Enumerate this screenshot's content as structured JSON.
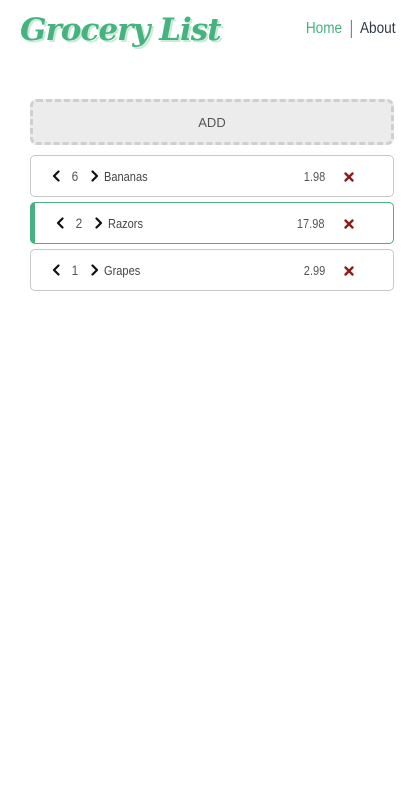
{
  "header": {
    "logo": "Grocery List",
    "nav": {
      "home": "Home",
      "about": "About"
    }
  },
  "add_button": {
    "label": "ADD"
  },
  "items": [
    {
      "qty": "6",
      "name": "Bananas",
      "price": "1.98"
    },
    {
      "qty": "2",
      "name": "Razors",
      "price": "17.98"
    },
    {
      "qty": "1",
      "name": "Grapes",
      "price": "2.99"
    }
  ],
  "colors": {
    "accent": "#45b27f",
    "remove": "#8b1a1a",
    "text": "#444444"
  },
  "icons": {
    "decrease": "chevron-left-icon",
    "increase": "chevron-right-icon",
    "remove": "close-icon"
  }
}
